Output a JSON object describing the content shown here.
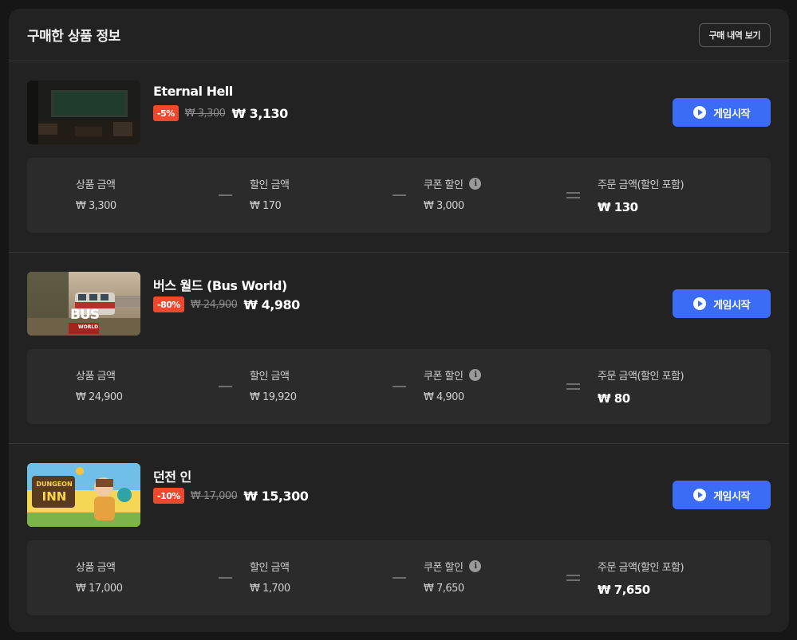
{
  "header": {
    "title": "구매한 상품 정보",
    "history_button": "구매 내역 보기"
  },
  "labels": {
    "product_price": "상품 금액",
    "discount_amount": "할인 금액",
    "coupon_discount": "쿠폰 할인",
    "order_total": "주문 금액(할인 포함)",
    "play_button": "게임시작",
    "info_glyph": "i"
  },
  "products": [
    {
      "name": "Eternal Hell",
      "discount_badge": "-5%",
      "original_price": "₩ 3,300",
      "final_price": "₩ 3,130",
      "summary": {
        "product_price": "₩ 3,300",
        "discount_amount": "₩ 170",
        "coupon_discount": "₩ 3,000",
        "order_total": "₩ 130"
      }
    },
    {
      "name": "버스 월드 (Bus World)",
      "discount_badge": "-80%",
      "original_price": "₩ 24,900",
      "final_price": "₩ 4,980",
      "thumb_text": "BUS",
      "thumb_subtext": "WORLD",
      "summary": {
        "product_price": "₩ 24,900",
        "discount_amount": "₩ 19,920",
        "coupon_discount": "₩ 4,900",
        "order_total": "₩ 80"
      }
    },
    {
      "name": "던전 인",
      "discount_badge": "-10%",
      "original_price": "₩ 17,000",
      "final_price": "₩ 15,300",
      "thumb_text": "DUNGEON",
      "thumb_subtext": "INN",
      "summary": {
        "product_price": "₩ 17,000",
        "discount_amount": "₩ 1,700",
        "coupon_discount": "₩ 7,650",
        "order_total": "₩ 7,650"
      }
    }
  ],
  "colors": {
    "accent": "#3b6cf6",
    "badge": "#f0482f",
    "panel": "#222222",
    "summary_bg": "#2b2b2b"
  }
}
